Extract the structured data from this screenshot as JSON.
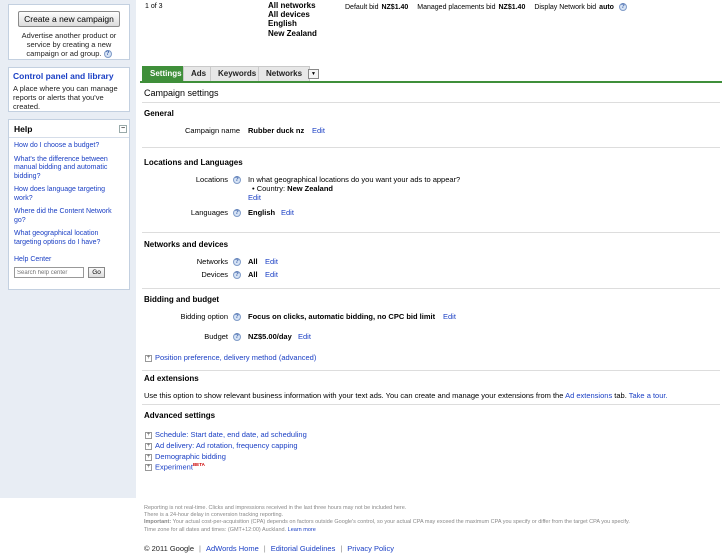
{
  "sidebar": {
    "create_button": "Create a new campaign",
    "create_text": "Advertise another product or service by creating a new campaign or ad group.",
    "control_title": "Control panel and library",
    "control_text": "A place where you can manage reports or alerts that you've created.",
    "help_title": "Help",
    "help_links": [
      "How do I choose a budget?",
      "What's the difference between manual bidding and automatic bidding?",
      "How does language targeting work?",
      "Where did the Content Network go?",
      "What geographical location targeting options do I have?"
    ],
    "help_center": "Help Center",
    "search_placeholder": "Search help center",
    "go_label": "Go"
  },
  "summary": {
    "paging": "1 of 3",
    "networks": "All networks",
    "devices": "All devices",
    "language": "English",
    "location": "New Zealand",
    "default_bid_label": "Default bid",
    "default_bid": "NZ$1.40",
    "managed_bid_label": "Managed placements bid",
    "managed_bid": "NZ$1.40",
    "display_bid_label": "Display Network bid",
    "display_bid": "auto"
  },
  "tabs": [
    "Settings",
    "Ads",
    "Keywords",
    "Networks"
  ],
  "main": {
    "page_title": "Campaign settings",
    "general_title": "General",
    "campaign_name_label": "Campaign name",
    "campaign_name": "Rubber duck nz",
    "edit": "Edit",
    "locations_title": "Locations and Languages",
    "locations_label": "Locations",
    "locations_question": "In what geographical locations do you want your ads to appear?",
    "country_label": "Country:",
    "country_value": "New Zealand",
    "languages_label": "Languages",
    "languages_value": "English",
    "networks_title": "Networks and devices",
    "networks_label": "Networks",
    "networks_value": "All",
    "devices_label": "Devices",
    "devices_value": "All",
    "bidding_title": "Bidding and budget",
    "bidding_label": "Bidding option",
    "bidding_value": "Focus on clicks, automatic bidding, no CPC bid limit",
    "budget_label": "Budget",
    "budget_value": "NZ$5.00/day",
    "position_pref": "Position preference, delivery method (advanced)",
    "ad_ext_title": "Ad extensions",
    "ad_ext_text": "Use this option to show relevant business information with your text ads. You can create and manage your extensions from the",
    "ad_ext_link": "Ad extensions",
    "ad_ext_tab": "tab.",
    "take_tour": "Take a tour.",
    "advanced_title": "Advanced settings",
    "advanced_items": [
      "Schedule: Start date, end date, ad scheduling",
      "Ad delivery: Ad rotation, frequency capping",
      "Demographic bidding",
      "Experiment"
    ],
    "beta": "BETA"
  },
  "footer": {
    "note1": "Reporting is not real-time. Clicks and impressions received in the last three hours may not be included here.",
    "note2": "There is a 24-hour delay in conversion tracking reporting.",
    "important_label": "Important:",
    "note3": "Your actual cost-per-acquisition (CPA) depends on factors outside Google's control, so your actual CPA may exceed the maximum CPA you specify or differ from the target CPA you specify.",
    "note4": "Time zone for all dates and times: (GMT+12:00) Auckland.",
    "learn_more": "Learn more",
    "copyright": "© 2011 Google",
    "adwords_home": "AdWords Home",
    "editorial": "Editorial Guidelines",
    "privacy": "Privacy Policy"
  }
}
